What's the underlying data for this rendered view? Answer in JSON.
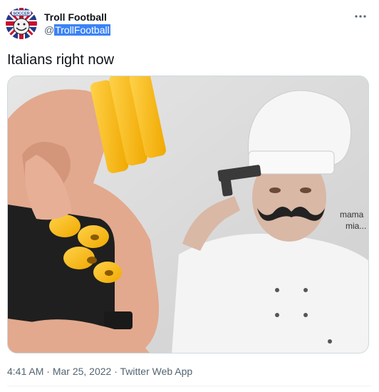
{
  "author": {
    "display_name": "Troll Football",
    "handle_prefix": "@",
    "handle_selected": "TrollFootball",
    "avatar_badge_text": "SOCCER"
  },
  "tweet": {
    "text": "Italians right now"
  },
  "media": {
    "caption_line1": "mama",
    "caption_line2": "mia..."
  },
  "meta": {
    "time": "4:41 AM",
    "separator1": " · ",
    "date": "Mar 25, 2022",
    "separator2": " · ",
    "source": "Twitter Web App"
  },
  "icons": {
    "more": "more-options-icon"
  },
  "colors": {
    "text": "#0f1419",
    "secondary": "#536471",
    "selection": "#3b82f6",
    "border": "#cfd9de"
  }
}
